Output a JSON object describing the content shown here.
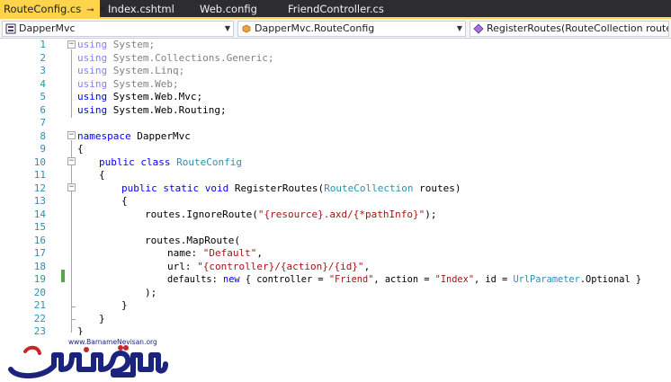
{
  "tabs": [
    {
      "label": "RouteConfig.cs",
      "pin_icon": "pin-icon",
      "close_icon": "close-icon"
    },
    {
      "label": "Index.cshtml"
    },
    {
      "label": "Web.config"
    },
    {
      "label": "FriendController.cs"
    }
  ],
  "navbar": {
    "project": "DapperMvc",
    "class": "DapperMvc.RouteConfig",
    "member": "RegisterRoutes(RouteCollection routes)"
  },
  "line_numbers": [
    "1",
    "2",
    "3",
    "4",
    "5",
    "6",
    "7",
    "8",
    "9",
    "10",
    "11",
    "12",
    "13",
    "14",
    "15",
    "16",
    "17",
    "18",
    "19",
    "20",
    "21",
    "22",
    "23"
  ],
  "code": {
    "l1_kw": "using",
    "l1_rest": " System;",
    "l2_kw": "using",
    "l2_rest": " System.Collections.Generic;",
    "l3_kw": "using",
    "l3_rest": " System.Linq;",
    "l4_kw": "using",
    "l4_rest": " System.Web;",
    "l5_kw": "using",
    "l5_rest": " System.Web.Mvc;",
    "l6_kw": "using",
    "l6_rest": " System.Web.Routing;",
    "l8_kw": "namespace",
    "l8_rest": " DapperMvc",
    "l9": "{",
    "l10_kw": "public class",
    "l10_sp": " ",
    "l10_type": "RouteConfig",
    "l11": "{",
    "l12_kw": "public static void",
    "l12_mid": " RegisterRoutes(",
    "l12_type": "RouteCollection",
    "l12_end": " routes)",
    "l13": "{",
    "l14_a": "routes.IgnoreRoute(",
    "l14_str": "\"{resource}.axd/{*pathInfo}\"",
    "l14_end": ");",
    "l16": "routes.MapRoute(",
    "l17_a": "name: ",
    "l17_str": "\"Default\"",
    "l17_end": ",",
    "l18_a": "url: ",
    "l18_str": "\"{controller}/{action}/{id}\"",
    "l18_end": ",",
    "l19_a": "defaults: ",
    "l19_kw": "new",
    "l19_b": " { controller = ",
    "l19_str1": "\"Friend\"",
    "l19_c": ", action = ",
    "l19_str2": "\"Index\"",
    "l19_d": ", id = ",
    "l19_type": "UrlParameter",
    "l19_e": ".Optional }",
    "l20": ");",
    "l21": "}",
    "l22": "}",
    "l23": "}"
  },
  "logo": {
    "url": "www.BarnameNevisan.org",
    "name": "برنامه نویسان"
  },
  "colors": {
    "keyword": "#0000ff",
    "type": "#2b91af",
    "string": "#a31515",
    "active_tab": "#ffd34b",
    "tab_strip": "#2d2d30"
  }
}
